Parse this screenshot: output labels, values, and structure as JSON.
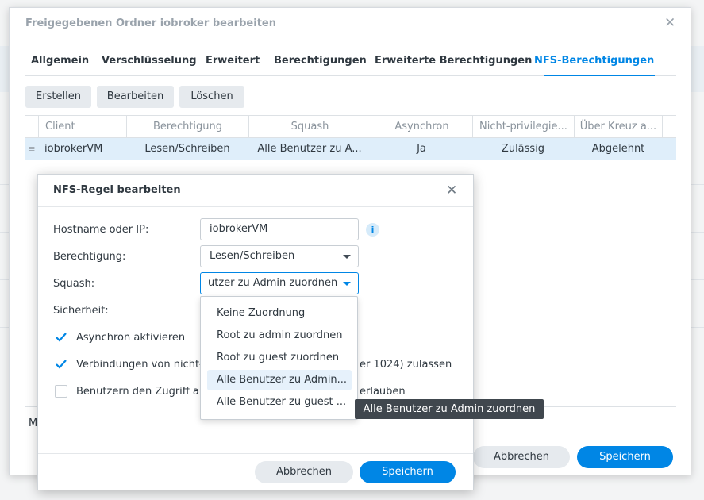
{
  "main_dialog": {
    "title": "Freigegebenen Ordner iobroker bearbeiten",
    "tabs": [
      {
        "label": "Allgemein",
        "active": false
      },
      {
        "label": "Verschlüsselung",
        "active": false
      },
      {
        "label": "Erweitert",
        "active": false
      },
      {
        "label": "Berechtigungen",
        "active": false
      },
      {
        "label": "Erweiterte Berechtigungen",
        "active": false
      },
      {
        "label": "NFS-Berechtigungen",
        "active": true
      }
    ],
    "toolbar": {
      "create_label": "Erstellen",
      "edit_label": "Bearbeiten",
      "delete_label": "Löschen"
    },
    "table": {
      "columns": [
        "Client",
        "Berechtigung",
        "Squash",
        "Asynchron",
        "Nicht-privilegie...",
        "Über Kreuz a..."
      ],
      "rows": [
        [
          "iobrokerVM",
          "Lesen/Schreiben",
          "Alle Benutzer zu A...",
          "Ja",
          "Zulässig",
          "Abgelehnt"
        ]
      ]
    },
    "partial_text": "M",
    "cancel_label": "Abbrechen",
    "save_label": "Speichern"
  },
  "rule_dialog": {
    "title": "NFS-Regel bearbeiten",
    "hostname_label": "Hostname oder IP:",
    "hostname_value": "iobrokerVM",
    "permission_label": "Berechtigung:",
    "permission_value": "Lesen/Schreiben",
    "squash_label": "Squash:",
    "squash_value": "utzer zu Admin zuordnen",
    "security_label": "Sicherheit:",
    "checkboxes": [
      {
        "label": "Asynchron aktivieren",
        "checked": true
      },
      {
        "label": "Verbindungen von nicht-",
        "label_tail": "er 1024) zulassen",
        "checked": true
      },
      {
        "label": "Benutzern den Zugriff a",
        "label_tail": "erlauben",
        "checked": false
      }
    ],
    "cancel_label": "Abbrechen",
    "save_label": "Speichern"
  },
  "squash_dropdown": {
    "options": [
      "Keine Zuordnung",
      "Root zu admin zuordnen",
      "Root zu guest zuordnen",
      "Alle Benutzer zu Admin...",
      "Alle Benutzer zu guest ..."
    ],
    "highlighted_index": 3
  },
  "tooltip": "Alle Benutzer zu Admin zuordnen",
  "icons": {
    "close": "close-icon",
    "info": "info-icon",
    "caret": "chevron-down-icon",
    "checkmark": "checkmark-icon",
    "drag": "drag-handle-icon"
  },
  "colors": {
    "accent": "#0086e5",
    "selected_row": "#dfeefa",
    "tooltip_bg": "#40474e"
  }
}
